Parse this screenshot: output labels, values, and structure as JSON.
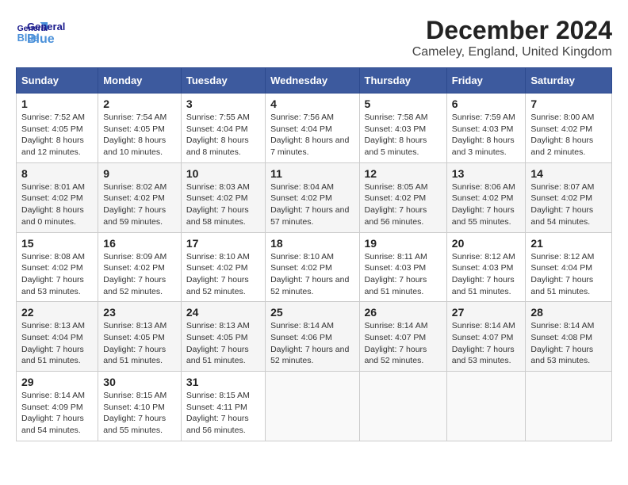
{
  "header": {
    "logo": {
      "general": "General",
      "blue": "Blue"
    },
    "title": "December 2024",
    "subtitle": "Cameley, England, United Kingdom"
  },
  "calendar": {
    "columns": [
      "Sunday",
      "Monday",
      "Tuesday",
      "Wednesday",
      "Thursday",
      "Friday",
      "Saturday"
    ],
    "weeks": [
      [
        {
          "day": "",
          "sunrise": "",
          "sunset": "",
          "daylight": "",
          "empty": true
        },
        {
          "day": "",
          "sunrise": "",
          "sunset": "",
          "daylight": "",
          "empty": true
        },
        {
          "day": "",
          "sunrise": "",
          "sunset": "",
          "daylight": "",
          "empty": true
        },
        {
          "day": "",
          "sunrise": "",
          "sunset": "",
          "daylight": "",
          "empty": true
        },
        {
          "day": "",
          "sunrise": "",
          "sunset": "",
          "daylight": "",
          "empty": true
        },
        {
          "day": "",
          "sunrise": "",
          "sunset": "",
          "daylight": "",
          "empty": true
        },
        {
          "day": "",
          "sunrise": "",
          "sunset": "",
          "daylight": "",
          "empty": true
        }
      ],
      [
        {
          "day": "1",
          "sunrise": "Sunrise: 7:52 AM",
          "sunset": "Sunset: 4:05 PM",
          "daylight": "Daylight: 8 hours and 12 minutes.",
          "empty": false
        },
        {
          "day": "2",
          "sunrise": "Sunrise: 7:54 AM",
          "sunset": "Sunset: 4:05 PM",
          "daylight": "Daylight: 8 hours and 10 minutes.",
          "empty": false
        },
        {
          "day": "3",
          "sunrise": "Sunrise: 7:55 AM",
          "sunset": "Sunset: 4:04 PM",
          "daylight": "Daylight: 8 hours and 8 minutes.",
          "empty": false
        },
        {
          "day": "4",
          "sunrise": "Sunrise: 7:56 AM",
          "sunset": "Sunset: 4:04 PM",
          "daylight": "Daylight: 8 hours and 7 minutes.",
          "empty": false
        },
        {
          "day": "5",
          "sunrise": "Sunrise: 7:58 AM",
          "sunset": "Sunset: 4:03 PM",
          "daylight": "Daylight: 8 hours and 5 minutes.",
          "empty": false
        },
        {
          "day": "6",
          "sunrise": "Sunrise: 7:59 AM",
          "sunset": "Sunset: 4:03 PM",
          "daylight": "Daylight: 8 hours and 3 minutes.",
          "empty": false
        },
        {
          "day": "7",
          "sunrise": "Sunrise: 8:00 AM",
          "sunset": "Sunset: 4:02 PM",
          "daylight": "Daylight: 8 hours and 2 minutes.",
          "empty": false
        }
      ],
      [
        {
          "day": "8",
          "sunrise": "Sunrise: 8:01 AM",
          "sunset": "Sunset: 4:02 PM",
          "daylight": "Daylight: 8 hours and 0 minutes.",
          "empty": false
        },
        {
          "day": "9",
          "sunrise": "Sunrise: 8:02 AM",
          "sunset": "Sunset: 4:02 PM",
          "daylight": "Daylight: 7 hours and 59 minutes.",
          "empty": false
        },
        {
          "day": "10",
          "sunrise": "Sunrise: 8:03 AM",
          "sunset": "Sunset: 4:02 PM",
          "daylight": "Daylight: 7 hours and 58 minutes.",
          "empty": false
        },
        {
          "day": "11",
          "sunrise": "Sunrise: 8:04 AM",
          "sunset": "Sunset: 4:02 PM",
          "daylight": "Daylight: 7 hours and 57 minutes.",
          "empty": false
        },
        {
          "day": "12",
          "sunrise": "Sunrise: 8:05 AM",
          "sunset": "Sunset: 4:02 PM",
          "daylight": "Daylight: 7 hours and 56 minutes.",
          "empty": false
        },
        {
          "day": "13",
          "sunrise": "Sunrise: 8:06 AM",
          "sunset": "Sunset: 4:02 PM",
          "daylight": "Daylight: 7 hours and 55 minutes.",
          "empty": false
        },
        {
          "day": "14",
          "sunrise": "Sunrise: 8:07 AM",
          "sunset": "Sunset: 4:02 PM",
          "daylight": "Daylight: 7 hours and 54 minutes.",
          "empty": false
        }
      ],
      [
        {
          "day": "15",
          "sunrise": "Sunrise: 8:08 AM",
          "sunset": "Sunset: 4:02 PM",
          "daylight": "Daylight: 7 hours and 53 minutes.",
          "empty": false
        },
        {
          "day": "16",
          "sunrise": "Sunrise: 8:09 AM",
          "sunset": "Sunset: 4:02 PM",
          "daylight": "Daylight: 7 hours and 52 minutes.",
          "empty": false
        },
        {
          "day": "17",
          "sunrise": "Sunrise: 8:10 AM",
          "sunset": "Sunset: 4:02 PM",
          "daylight": "Daylight: 7 hours and 52 minutes.",
          "empty": false
        },
        {
          "day": "18",
          "sunrise": "Sunrise: 8:10 AM",
          "sunset": "Sunset: 4:02 PM",
          "daylight": "Daylight: 7 hours and 52 minutes.",
          "empty": false
        },
        {
          "day": "19",
          "sunrise": "Sunrise: 8:11 AM",
          "sunset": "Sunset: 4:03 PM",
          "daylight": "Daylight: 7 hours and 51 minutes.",
          "empty": false
        },
        {
          "day": "20",
          "sunrise": "Sunrise: 8:12 AM",
          "sunset": "Sunset: 4:03 PM",
          "daylight": "Daylight: 7 hours and 51 minutes.",
          "empty": false
        },
        {
          "day": "21",
          "sunrise": "Sunrise: 8:12 AM",
          "sunset": "Sunset: 4:04 PM",
          "daylight": "Daylight: 7 hours and 51 minutes.",
          "empty": false
        }
      ],
      [
        {
          "day": "22",
          "sunrise": "Sunrise: 8:13 AM",
          "sunset": "Sunset: 4:04 PM",
          "daylight": "Daylight: 7 hours and 51 minutes.",
          "empty": false
        },
        {
          "day": "23",
          "sunrise": "Sunrise: 8:13 AM",
          "sunset": "Sunset: 4:05 PM",
          "daylight": "Daylight: 7 hours and 51 minutes.",
          "empty": false
        },
        {
          "day": "24",
          "sunrise": "Sunrise: 8:13 AM",
          "sunset": "Sunset: 4:05 PM",
          "daylight": "Daylight: 7 hours and 51 minutes.",
          "empty": false
        },
        {
          "day": "25",
          "sunrise": "Sunrise: 8:14 AM",
          "sunset": "Sunset: 4:06 PM",
          "daylight": "Daylight: 7 hours and 52 minutes.",
          "empty": false
        },
        {
          "day": "26",
          "sunrise": "Sunrise: 8:14 AM",
          "sunset": "Sunset: 4:07 PM",
          "daylight": "Daylight: 7 hours and 52 minutes.",
          "empty": false
        },
        {
          "day": "27",
          "sunrise": "Sunrise: 8:14 AM",
          "sunset": "Sunset: 4:07 PM",
          "daylight": "Daylight: 7 hours and 53 minutes.",
          "empty": false
        },
        {
          "day": "28",
          "sunrise": "Sunrise: 8:14 AM",
          "sunset": "Sunset: 4:08 PM",
          "daylight": "Daylight: 7 hours and 53 minutes.",
          "empty": false
        }
      ],
      [
        {
          "day": "29",
          "sunrise": "Sunrise: 8:14 AM",
          "sunset": "Sunset: 4:09 PM",
          "daylight": "Daylight: 7 hours and 54 minutes.",
          "empty": false
        },
        {
          "day": "30",
          "sunrise": "Sunrise: 8:15 AM",
          "sunset": "Sunset: 4:10 PM",
          "daylight": "Daylight: 7 hours and 55 minutes.",
          "empty": false
        },
        {
          "day": "31",
          "sunrise": "Sunrise: 8:15 AM",
          "sunset": "Sunset: 4:11 PM",
          "daylight": "Daylight: 7 hours and 56 minutes.",
          "empty": false
        },
        {
          "day": "",
          "sunrise": "",
          "sunset": "",
          "daylight": "",
          "empty": true
        },
        {
          "day": "",
          "sunrise": "",
          "sunset": "",
          "daylight": "",
          "empty": true
        },
        {
          "day": "",
          "sunrise": "",
          "sunset": "",
          "daylight": "",
          "empty": true
        },
        {
          "day": "",
          "sunrise": "",
          "sunset": "",
          "daylight": "",
          "empty": true
        }
      ]
    ]
  }
}
